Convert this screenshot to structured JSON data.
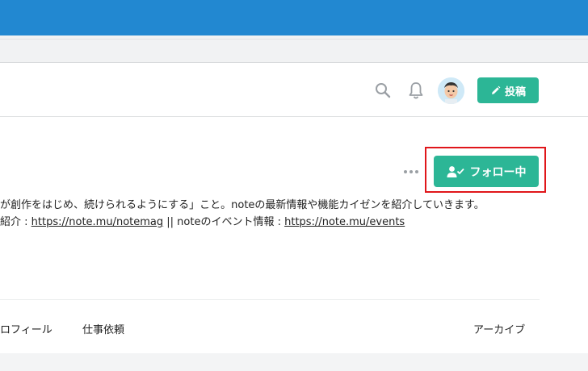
{
  "header": {
    "post_label": "投稿"
  },
  "profile": {
    "follow_label": "フォロー中",
    "description_line1": "が創作をはじめ、続けられるようにする」こと。noteの最新情報や機能カイゼンを紹介していきます。",
    "description_line2_prefix": "紹介 : ",
    "link1": "https://note.mu/notemag",
    "description_line2_middle": " || noteのイベント情報 : ",
    "link2": "https://note.mu/events"
  },
  "tabs": [
    {
      "label": "ロフィール"
    },
    {
      "label": "仕事依頼"
    },
    {
      "label": "アーカイブ"
    }
  ],
  "colors": {
    "browser_bar": "#2288d1",
    "accent_green": "#2cb696",
    "highlight_red": "#e0161a"
  },
  "icons": [
    "search-icon",
    "bell-icon",
    "pencil-icon",
    "more-dots-icon",
    "user-check-icon"
  ]
}
